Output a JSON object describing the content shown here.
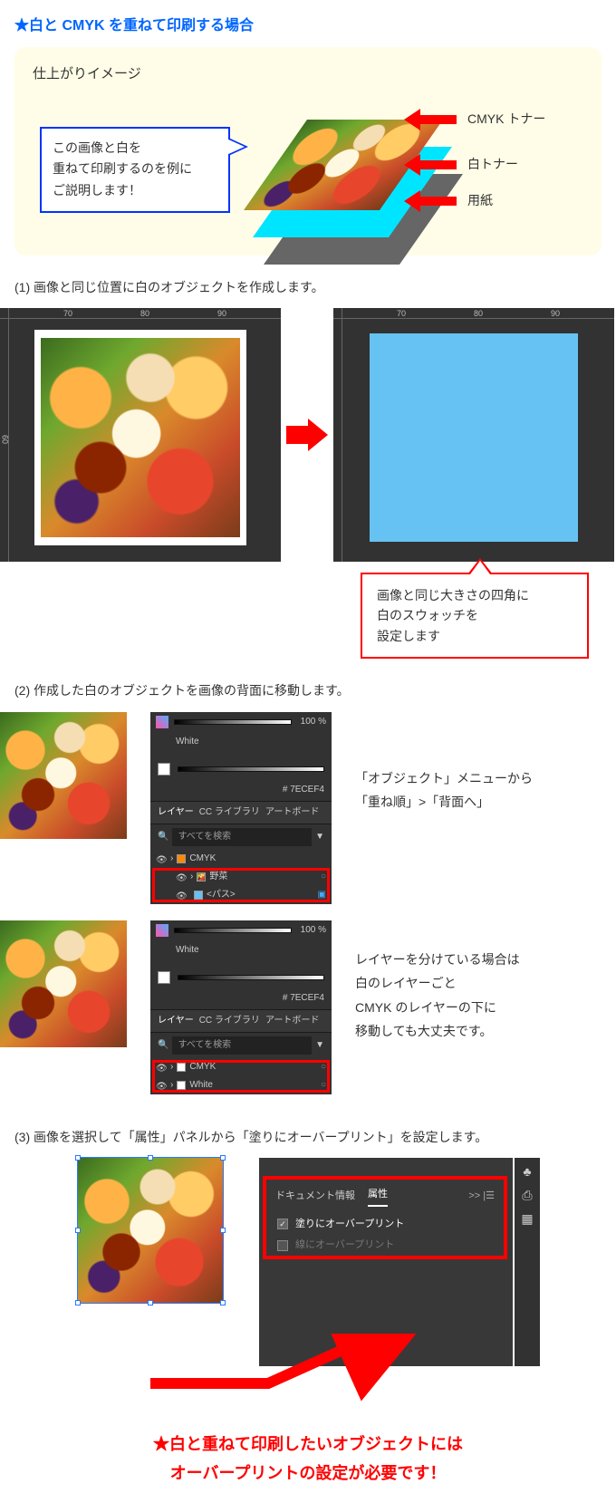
{
  "title": "★白と CMYK を重ねて印刷する場合",
  "yellow": {
    "heading": "仕上がりイメージ",
    "speech": "この画像と白を\n重ねて印刷するのを例に\nご説明します！",
    "labels": {
      "cmyk": "CMYK トナー",
      "white": "白トナー",
      "paper": "用紙"
    }
  },
  "step1": {
    "heading": "(1) 画像と同じ位置に白のオブジェクトを作成します。",
    "ruler": {
      "a": "70",
      "b": "80",
      "c": "90"
    },
    "ruler_left": "60",
    "callout": "画像と同じ大きさの四角に\n白のスウォッチを\n設定します"
  },
  "step2": {
    "heading": "(2) 作成した白のオブジェクトを画像の背面に移動します。",
    "panel1": {
      "pct": "100 %",
      "color_name": "White",
      "hex_label": "# 7ECEF4",
      "tabs": {
        "a": "レイヤー",
        "b": "CC ライブラリ",
        "c": "アートボード"
      },
      "search": "すべてを検索",
      "cmyk_layer": "CMYK",
      "items": {
        "a": "野菜",
        "b": "<パス>"
      }
    },
    "panel2": {
      "pct": "100 %",
      "color_name": "White",
      "hex_label": "# 7ECEF4",
      "tabs": {
        "a": "レイヤー",
        "b": "CC ライブラリ",
        "c": "アートボード"
      },
      "search": "すべてを検索",
      "layers": {
        "a": "CMYK",
        "b": "White"
      }
    },
    "text1": "「オブジェクト」メニューから\n「重ね順」>「背面へ」",
    "text2": "レイヤーを分けている場合は\n白のレイヤーごと\nCMYK のレイヤーの下に\n移動しても大丈夫です。"
  },
  "step3": {
    "heading": "(3) 画像を選択して「属性」パネルから「塗りにオーバープリント」を設定します。",
    "tabs": {
      "a": "ドキュメント情報",
      "b": "属性",
      "menu": ">> |☰"
    },
    "fill": "塗りにオーバープリント",
    "stroke": "線にオーバープリント"
  },
  "summary": "★白と重ねて印刷したいオブジェクトには\nオーバープリントの設定が必要です！"
}
